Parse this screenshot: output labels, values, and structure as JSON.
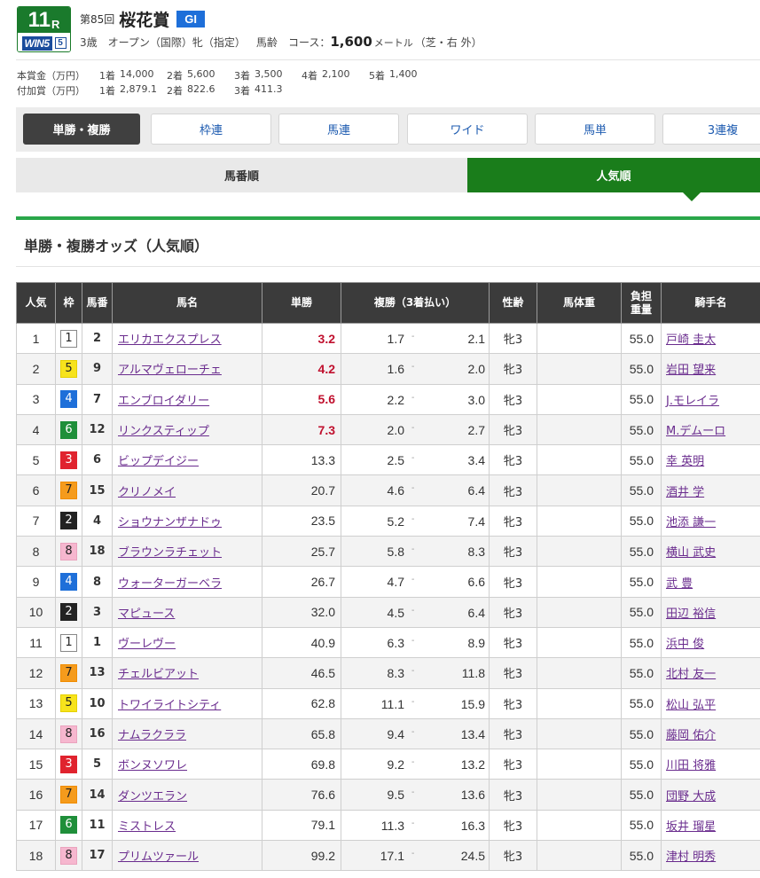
{
  "race": {
    "number": "11",
    "r_suffix": "R",
    "win5_label": "WIN5",
    "win5_num": "5",
    "kai": "第85回",
    "name": "桜花賞",
    "grade": "GI",
    "conditions": [
      "3歳",
      "オープン（国際）牝（指定）",
      "馬齢"
    ],
    "course_label": "コース：",
    "distance": "1,600",
    "distance_unit": "メートル",
    "surface": "（芝・右 外）"
  },
  "prize": {
    "main_label": "本賞金（万円）",
    "main": [
      {
        "place": "1着",
        "value": "14,000"
      },
      {
        "place": "2着",
        "value": "5,600"
      },
      {
        "place": "3着",
        "value": "3,500"
      },
      {
        "place": "4着",
        "value": "2,100"
      },
      {
        "place": "5着",
        "value": "1,400"
      }
    ],
    "extra_label": "付加賞（万円）",
    "extra": [
      {
        "place": "1着",
        "value": "2,879.1"
      },
      {
        "place": "2着",
        "value": "822.6"
      },
      {
        "place": "3着",
        "value": "411.3"
      }
    ]
  },
  "bet_tabs": [
    "単勝・複勝",
    "枠連",
    "馬連",
    "ワイド",
    "馬単",
    "3連複"
  ],
  "sort_tabs": {
    "left": "馬番順",
    "right": "人気順"
  },
  "section_title": "単勝・複勝オッズ（人気順）",
  "columns": {
    "ninki": "人気",
    "waku": "枠",
    "umaban": "馬番",
    "name": "馬名",
    "tan": "単勝",
    "fuku": "複勝（3着払い）",
    "sexage": "性齢",
    "bodyweight": "馬体重",
    "burden_1": "負担",
    "burden_2": "重量",
    "jockey": "騎手名"
  },
  "horses": [
    {
      "ninki": "1",
      "waku": "1",
      "umaban": "2",
      "name": "エリカエクスプレス",
      "tan": "3.2",
      "hot": true,
      "fuku_lo": "1.7",
      "fuku_hi": "2.1",
      "sexage": "牝3",
      "bodyweight": "",
      "weight": "55.0",
      "jockey": "戸崎 圭太"
    },
    {
      "ninki": "2",
      "waku": "5",
      "umaban": "9",
      "name": "アルマヴェローチェ",
      "tan": "4.2",
      "hot": true,
      "fuku_lo": "1.6",
      "fuku_hi": "2.0",
      "sexage": "牝3",
      "bodyweight": "",
      "weight": "55.0",
      "jockey": "岩田 望来"
    },
    {
      "ninki": "3",
      "waku": "4",
      "umaban": "7",
      "name": "エンブロイダリー",
      "tan": "5.6",
      "hot": true,
      "fuku_lo": "2.2",
      "fuku_hi": "3.0",
      "sexage": "牝3",
      "bodyweight": "",
      "weight": "55.0",
      "jockey": "J.モレイラ"
    },
    {
      "ninki": "4",
      "waku": "6",
      "umaban": "12",
      "name": "リンクスティップ",
      "tan": "7.3",
      "hot": true,
      "fuku_lo": "2.0",
      "fuku_hi": "2.7",
      "sexage": "牝3",
      "bodyweight": "",
      "weight": "55.0",
      "jockey": "M.デムーロ"
    },
    {
      "ninki": "5",
      "waku": "3",
      "umaban": "6",
      "name": "ビップデイジー",
      "tan": "13.3",
      "hot": false,
      "fuku_lo": "2.5",
      "fuku_hi": "3.4",
      "sexage": "牝3",
      "bodyweight": "",
      "weight": "55.0",
      "jockey": "幸 英明"
    },
    {
      "ninki": "6",
      "waku": "7",
      "umaban": "15",
      "name": "クリノメイ",
      "tan": "20.7",
      "hot": false,
      "fuku_lo": "4.6",
      "fuku_hi": "6.4",
      "sexage": "牝3",
      "bodyweight": "",
      "weight": "55.0",
      "jockey": "酒井 学"
    },
    {
      "ninki": "7",
      "waku": "2",
      "umaban": "4",
      "name": "ショウナンザナドゥ",
      "tan": "23.5",
      "hot": false,
      "fuku_lo": "5.2",
      "fuku_hi": "7.4",
      "sexage": "牝3",
      "bodyweight": "",
      "weight": "55.0",
      "jockey": "池添 謙一"
    },
    {
      "ninki": "8",
      "waku": "8",
      "umaban": "18",
      "name": "ブラウンラチェット",
      "tan": "25.7",
      "hot": false,
      "fuku_lo": "5.8",
      "fuku_hi": "8.3",
      "sexage": "牝3",
      "bodyweight": "",
      "weight": "55.0",
      "jockey": "横山 武史"
    },
    {
      "ninki": "9",
      "waku": "4",
      "umaban": "8",
      "name": "ウォーターガーベラ",
      "tan": "26.7",
      "hot": false,
      "fuku_lo": "4.7",
      "fuku_hi": "6.6",
      "sexage": "牝3",
      "bodyweight": "",
      "weight": "55.0",
      "jockey": "武 豊"
    },
    {
      "ninki": "10",
      "waku": "2",
      "umaban": "3",
      "name": "マピュース",
      "tan": "32.0",
      "hot": false,
      "fuku_lo": "4.5",
      "fuku_hi": "6.4",
      "sexage": "牝3",
      "bodyweight": "",
      "weight": "55.0",
      "jockey": "田辺 裕信"
    },
    {
      "ninki": "11",
      "waku": "1",
      "umaban": "1",
      "name": "ヴーレヴー",
      "tan": "40.9",
      "hot": false,
      "fuku_lo": "6.3",
      "fuku_hi": "8.9",
      "sexage": "牝3",
      "bodyweight": "",
      "weight": "55.0",
      "jockey": "浜中 俊"
    },
    {
      "ninki": "12",
      "waku": "7",
      "umaban": "13",
      "name": "チェルビアット",
      "tan": "46.5",
      "hot": false,
      "fuku_lo": "8.3",
      "fuku_hi": "11.8",
      "sexage": "牝3",
      "bodyweight": "",
      "weight": "55.0",
      "jockey": "北村 友一"
    },
    {
      "ninki": "13",
      "waku": "5",
      "umaban": "10",
      "name": "トワイライトシティ",
      "tan": "62.8",
      "hot": false,
      "fuku_lo": "11.1",
      "fuku_hi": "15.9",
      "sexage": "牝3",
      "bodyweight": "",
      "weight": "55.0",
      "jockey": "松山 弘平"
    },
    {
      "ninki": "14",
      "waku": "8",
      "umaban": "16",
      "name": "ナムラクララ",
      "tan": "65.8",
      "hot": false,
      "fuku_lo": "9.4",
      "fuku_hi": "13.4",
      "sexage": "牝3",
      "bodyweight": "",
      "weight": "55.0",
      "jockey": "藤岡 佑介"
    },
    {
      "ninki": "15",
      "waku": "3",
      "umaban": "5",
      "name": "ボンヌソワレ",
      "tan": "69.8",
      "hot": false,
      "fuku_lo": "9.2",
      "fuku_hi": "13.2",
      "sexage": "牝3",
      "bodyweight": "",
      "weight": "55.0",
      "jockey": "川田 将雅"
    },
    {
      "ninki": "16",
      "waku": "7",
      "umaban": "14",
      "name": "ダンツエラン",
      "tan": "76.6",
      "hot": false,
      "fuku_lo": "9.5",
      "fuku_hi": "13.6",
      "sexage": "牝3",
      "bodyweight": "",
      "weight": "55.0",
      "jockey": "団野 大成"
    },
    {
      "ninki": "17",
      "waku": "6",
      "umaban": "11",
      "name": "ミストレス",
      "tan": "79.1",
      "hot": false,
      "fuku_lo": "11.3",
      "fuku_hi": "16.3",
      "sexage": "牝3",
      "bodyweight": "",
      "weight": "55.0",
      "jockey": "坂井 瑠星"
    },
    {
      "ninki": "18",
      "waku": "8",
      "umaban": "17",
      "name": "プリムツァール",
      "tan": "99.2",
      "hot": false,
      "fuku_lo": "17.1",
      "fuku_hi": "24.5",
      "sexage": "牝3",
      "bodyweight": "",
      "weight": "55.0",
      "jockey": "津村 明秀"
    }
  ],
  "colors": {
    "brand_green": "#1a7d1b",
    "accent_line": "#2aa64a",
    "grade_blue": "#1e6fd9",
    "hot_odds_red": "#c0102e",
    "link_purple": "#6a2c8e",
    "header_dark": "#3b3b3b"
  }
}
